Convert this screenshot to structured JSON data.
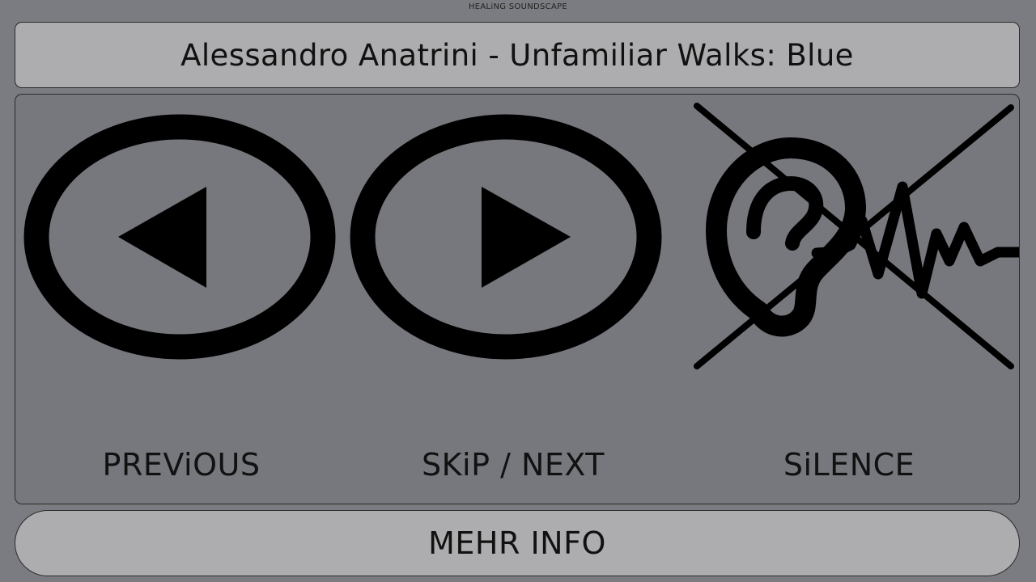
{
  "app": {
    "title": "HEALiNG SOUNDSCAPE"
  },
  "now_playing": {
    "title": "Alessandro Anatrini - Unfamiliar Walks: Blue"
  },
  "controls": {
    "previous": {
      "label": "PREViOUS",
      "icon": "previous-icon"
    },
    "next": {
      "label": "SKiP / NEXT",
      "icon": "play-next-icon"
    },
    "silence": {
      "label": "SiLENCE",
      "icon": "ear-muted-icon"
    }
  },
  "footer": {
    "more_info_label": "MEHR INFO"
  },
  "colors": {
    "background": "#7b7c81",
    "panel": "#77787e",
    "button_fill": "#adadaf",
    "icon": "#000000"
  }
}
